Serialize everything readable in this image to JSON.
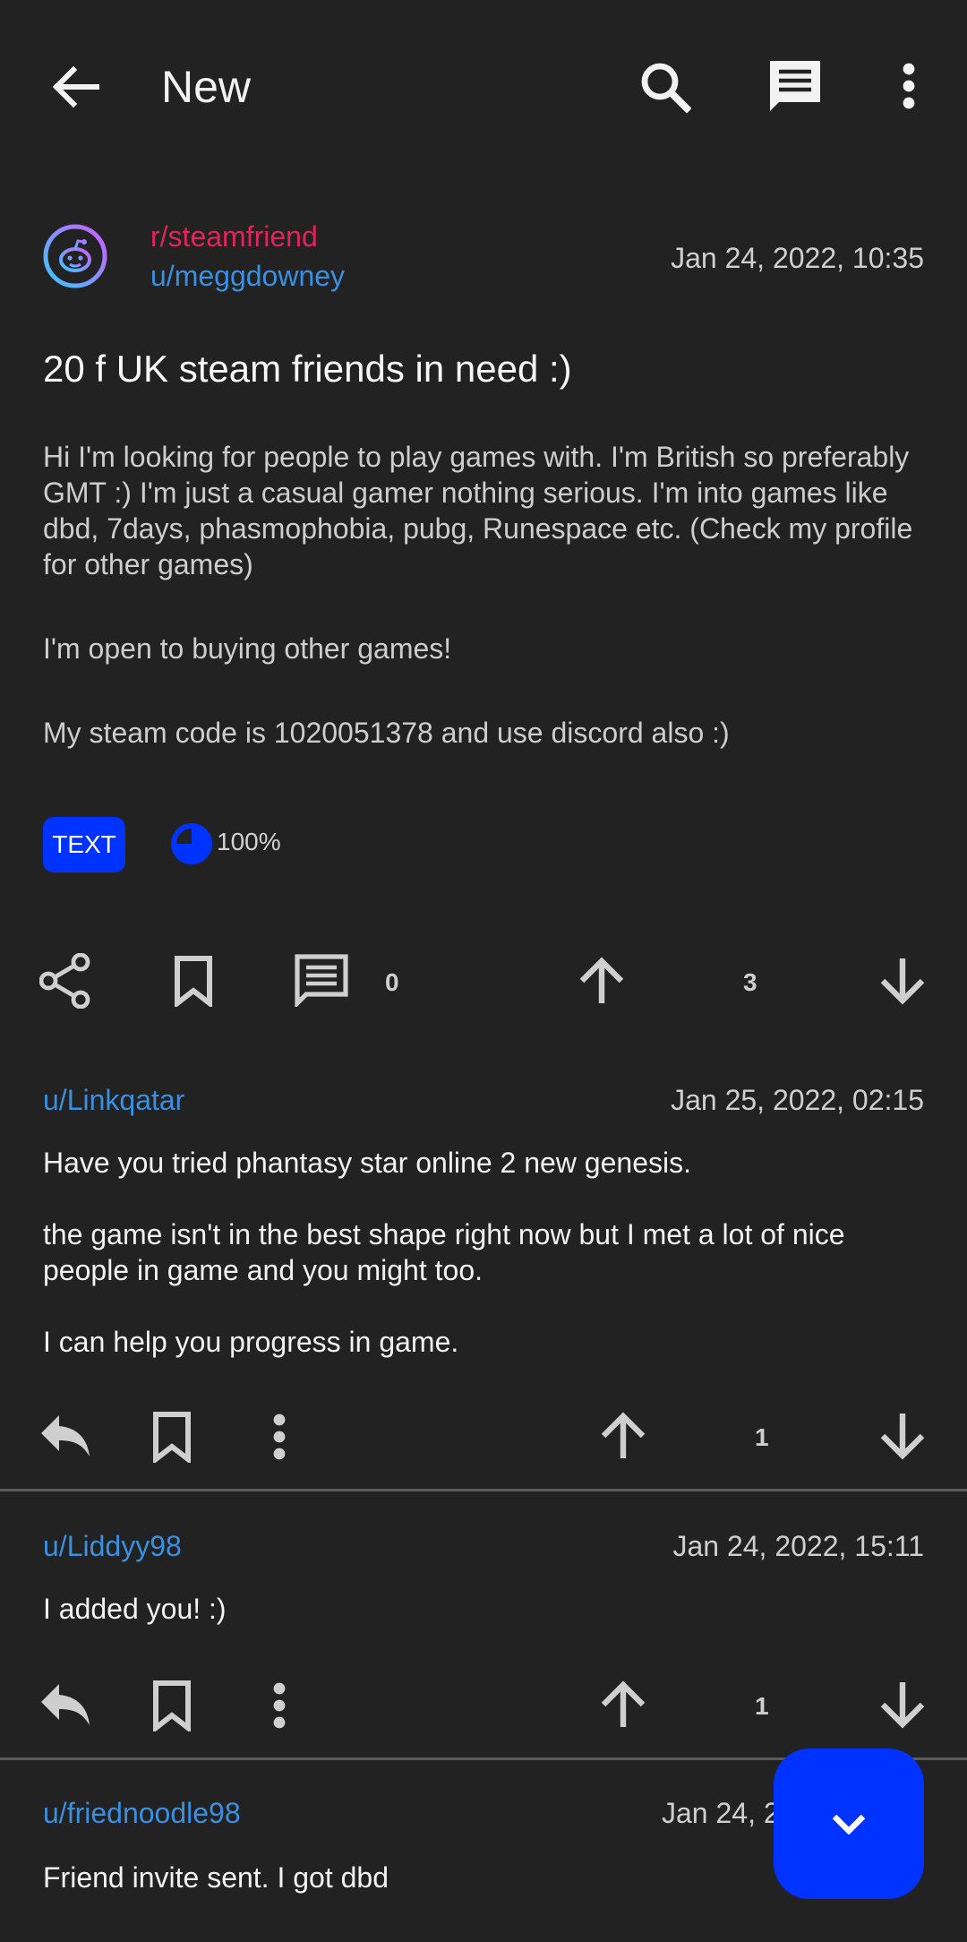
{
  "colors": {
    "background": "#222222",
    "subreddit": "#e0245e",
    "username": "#3b8fe0",
    "accent_blue": "#0033ff",
    "icon_gray": "#cfcfcf"
  },
  "toolbar": {
    "title": "New",
    "icons": [
      "back-arrow-icon",
      "search-icon",
      "comment-icon",
      "more-vertical-icon"
    ]
  },
  "post": {
    "subreddit": "r/steamfriend",
    "author": "u/meggdowney",
    "timestamp": "Jan 24, 2022, 10:35",
    "title": "20 f UK steam friends in need :)",
    "body": [
      "Hi I'm looking for people to play games with. I'm British so preferably GMT :) I'm just a casual gamer nothing serious. I'm into games like dbd, 7days, phasmophobia, pubg, Runespace etc. (Check my profile for other games)",
      "I'm open to buying other games!",
      "My steam code is 1020051378 and use discord also :)"
    ],
    "type_tag": "TEXT",
    "upvote_ratio": "100%",
    "comment_count": "0",
    "score": "3"
  },
  "comments": [
    {
      "author": "u/Linkqatar",
      "timestamp": "Jan 25, 2022, 02:15",
      "body": [
        "Have you tried phantasy star online 2 new genesis.",
        "the game isn't in the best shape right now but I met a lot of nice people in game and you might too.",
        "I can help you progress in game."
      ],
      "score": "1"
    },
    {
      "author": "u/Liddyy98",
      "timestamp": "Jan 24, 2022, 15:11",
      "body": [
        "I added you! :)"
      ],
      "score": "1"
    },
    {
      "author": "u/friednoodle98",
      "timestamp": "Jan 24, 2",
      "body": [
        "Friend invite sent. I got dbd"
      ]
    }
  ]
}
